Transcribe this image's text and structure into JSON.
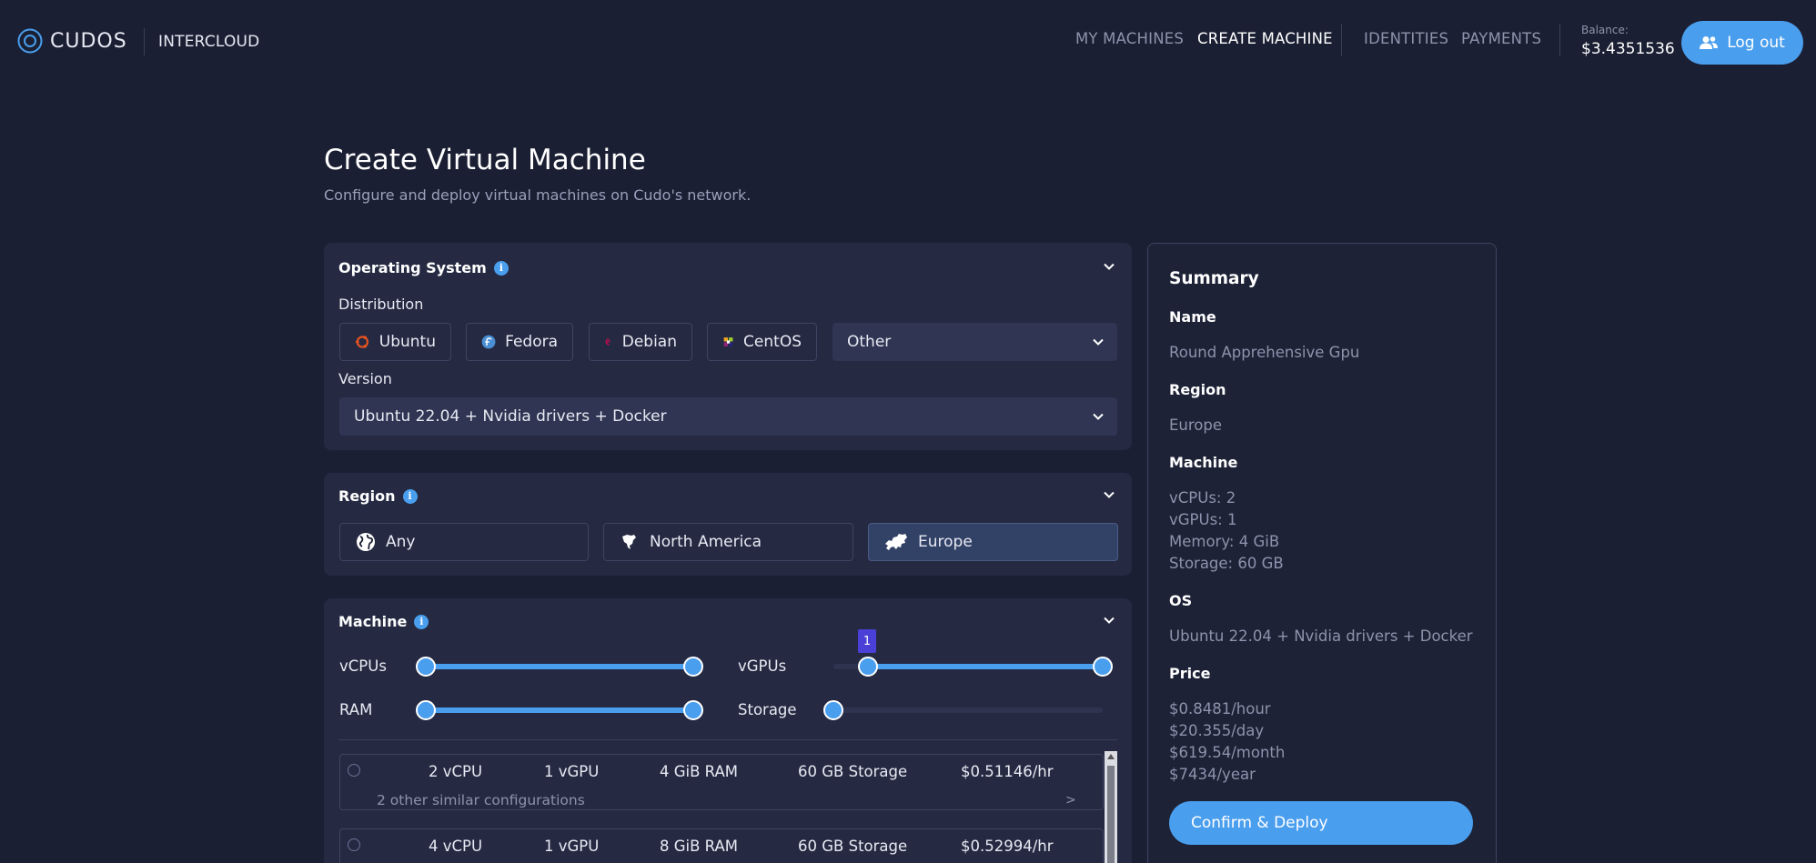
{
  "header": {
    "logo_text": "CUDOS",
    "product": "INTERCLOUD",
    "nav": [
      "MY MACHINES",
      "CREATE MACHINE",
      "IDENTITIES",
      "PAYMENTS"
    ],
    "balance_label": "Balance:",
    "balance_value": "$3.4351536",
    "logout_label": "Log out"
  },
  "page": {
    "title": "Create Virtual Machine",
    "subtitle": "Configure and deploy virtual machines on Cudo's network."
  },
  "os_panel": {
    "title": "Operating System",
    "distribution_label": "Distribution",
    "distributions": [
      "Ubuntu",
      "Fedora",
      "Debian",
      "CentOS"
    ],
    "other_select": "Other",
    "version_label": "Version",
    "version_value": "Ubuntu 22.04 + Nvidia drivers + Docker"
  },
  "region_panel": {
    "title": "Region",
    "options": [
      "Any",
      "North America",
      "Europe"
    ],
    "selected": "Europe"
  },
  "machine_panel": {
    "title": "Machine",
    "sliders": {
      "vcpus_label": "vCPUs",
      "vgpus_label": "vGPUs",
      "ram_label": "RAM",
      "storage_label": "Storage",
      "vgpu_tooltip": "1"
    },
    "configs": [
      {
        "vcpu": "2 vCPU",
        "vgpu": "1 vGPU",
        "ram": "4 GiB RAM",
        "storage": "60 GB Storage",
        "price": "$0.51146/hr",
        "similar": "2 other similar configurations",
        "arrow": ">"
      },
      {
        "vcpu": "4 vCPU",
        "vgpu": "1 vGPU",
        "ram": "8 GiB RAM",
        "storage": "60 GB Storage",
        "price": "$0.52994/hr"
      }
    ]
  },
  "summary": {
    "title": "Summary",
    "name_label": "Name",
    "name_value": "Round Apprehensive Gpu",
    "region_label": "Region",
    "region_value": "Europe",
    "machine_label": "Machine",
    "machine_lines": [
      "vCPUs: 2",
      "vGPUs: 1",
      "Memory: 4 GiB",
      "Storage: 60 GB"
    ],
    "os_label": "OS",
    "os_value": "Ubuntu 22.04 + Nvidia drivers + Docker",
    "price_label": "Price",
    "price_lines": [
      "$0.8481/hour",
      "$20.355/day",
      "$619.54/month",
      "$7434/year"
    ],
    "deploy_label": "Confirm & Deploy"
  },
  "colors": {
    "background": "#1b1f33",
    "panel": "#252a42",
    "accent": "#4a9eee",
    "tooltip": "#4a3fd6"
  },
  "icons": [
    "cudos-logo-icon",
    "users-icon",
    "info-icon",
    "chevron-down-icon",
    "ubuntu-icon",
    "fedora-icon",
    "debian-icon",
    "centos-icon",
    "globe-icon",
    "north-america-icon",
    "europe-icon"
  ]
}
